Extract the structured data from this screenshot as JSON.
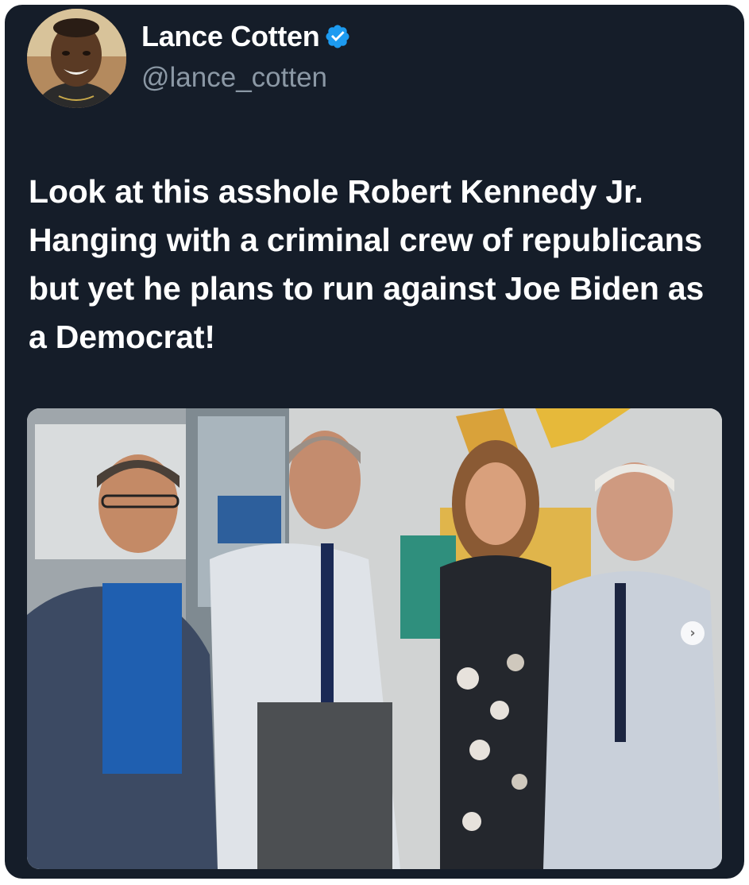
{
  "tweet": {
    "author": {
      "display_name": "Lance Cotten",
      "handle": "@lance_cotten",
      "verified": true,
      "verified_color": "#1d9bf0"
    },
    "text": "Look at this asshole Robert Kennedy Jr.  Hanging with a criminal crew of republicans but yet he plans to run against Joe Biden as a Democrat!",
    "media": {
      "type": "photo",
      "next_icon": "chevron-right-icon",
      "next_glyph": "›"
    }
  },
  "colors": {
    "card_background": "#151d29",
    "text_primary": "#ffffff",
    "text_secondary": "#8b98a5"
  }
}
